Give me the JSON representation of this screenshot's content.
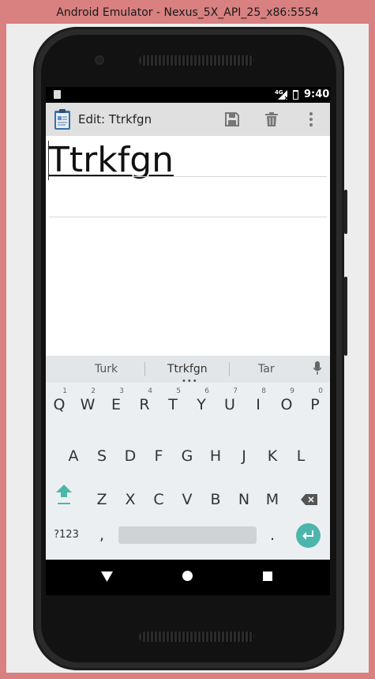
{
  "window": {
    "title": "Android Emulator - Nexus_5X_API_25_x86:5554"
  },
  "status_bar": {
    "network": "4G",
    "time": "9:40"
  },
  "app_bar": {
    "title": "Edit: Ttrkfgn"
  },
  "editor": {
    "title_value": "Ttrkfgn",
    "body_value": ""
  },
  "keyboard": {
    "suggestions": [
      "Turk",
      "Ttrkfgn",
      "Tar"
    ],
    "row1": [
      {
        "label": "Q",
        "hint": "1"
      },
      {
        "label": "W",
        "hint": "2"
      },
      {
        "label": "E",
        "hint": "3"
      },
      {
        "label": "R",
        "hint": "4"
      },
      {
        "label": "T",
        "hint": "5"
      },
      {
        "label": "Y",
        "hint": "6"
      },
      {
        "label": "U",
        "hint": "7"
      },
      {
        "label": "I",
        "hint": "8"
      },
      {
        "label": "O",
        "hint": "9"
      },
      {
        "label": "P",
        "hint": "0"
      }
    ],
    "row2": [
      "A",
      "S",
      "D",
      "F",
      "G",
      "H",
      "J",
      "K",
      "L"
    ],
    "row3": [
      "Z",
      "X",
      "C",
      "V",
      "B",
      "N",
      "M"
    ],
    "symbols_label": "?123",
    "comma": ",",
    "period": "."
  },
  "colors": {
    "accent": "#4db6ac",
    "app_bar": "#e0e0e0",
    "keyboard_bg": "#eceff1"
  }
}
